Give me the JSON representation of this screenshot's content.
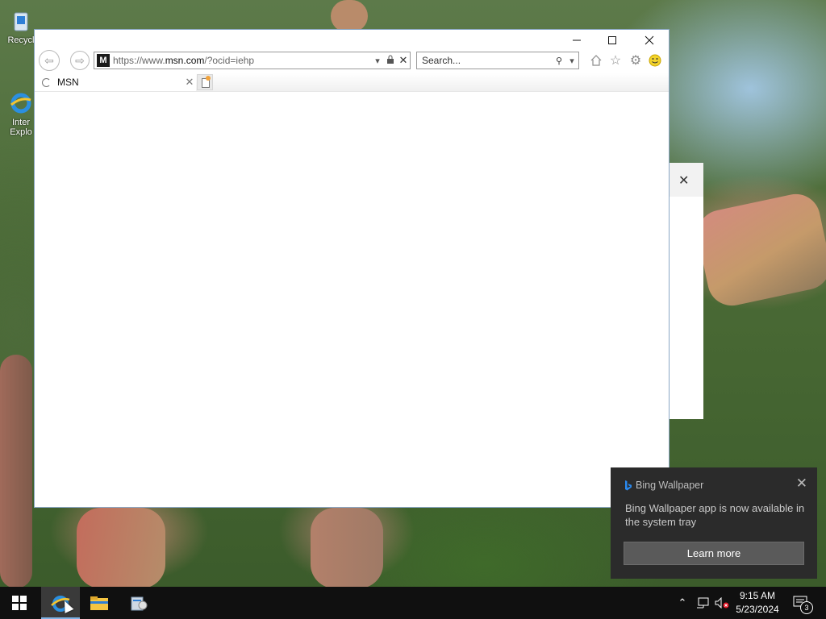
{
  "desktop": {
    "icons": [
      {
        "label": "Recycl"
      },
      {
        "label": "Inter Explo"
      }
    ]
  },
  "browser": {
    "address": {
      "url_prefix": "https://www.",
      "url_domain": "msn.com",
      "url_suffix": "/?ocid=iehp",
      "favicon_letter": "M"
    },
    "search": {
      "placeholder": "Search..."
    },
    "tabs": [
      {
        "label": "MSN",
        "loading": true
      }
    ]
  },
  "toast": {
    "app_name": "Bing Wallpaper",
    "message": "Bing Wallpaper app is now available in the system tray",
    "button_label": "Learn more"
  },
  "taskbar": {
    "clock_time": "9:15 AM",
    "clock_date": "5/23/2024",
    "notification_count": "3"
  },
  "colors": {
    "taskbar": "#101010",
    "toast_bg": "#2b2b2b",
    "accent": "#7fb2e5"
  }
}
